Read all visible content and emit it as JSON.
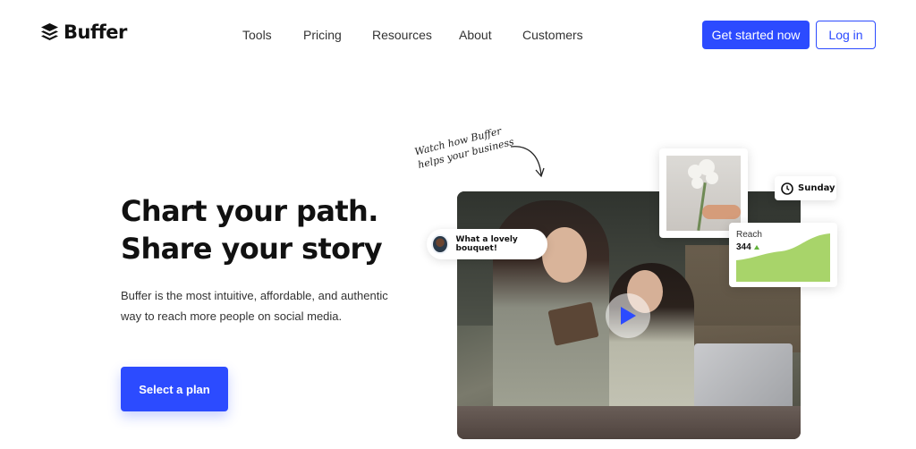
{
  "brand": {
    "name": "Buffer",
    "accent": "#2c4bff"
  },
  "nav": {
    "items": [
      {
        "label": "Tools"
      },
      {
        "label": "Pricing"
      },
      {
        "label": "Resources"
      },
      {
        "label": "About"
      },
      {
        "label": "Customers"
      }
    ],
    "cta_label": "Get started now",
    "login_label": "Log in"
  },
  "hero": {
    "headline_line1": "Chart your path.",
    "headline_line2": "Share your story",
    "subtitle": "Buffer is the most intuitive, affordable, and authentic way to reach more people on social media.",
    "cta_label": "Select a plan"
  },
  "showcase": {
    "handwritten_note": "Watch how Buffer helps your business",
    "comment_text": "What a lovely bouquet!",
    "schedule_day": "Sunday",
    "reach_label": "Reach",
    "reach_value": "344",
    "reach_color": "#a8d46a",
    "icons": [
      "buffer-logo-icon",
      "arrow-icon",
      "play-icon",
      "clock-icon",
      "trend-up-icon"
    ]
  }
}
